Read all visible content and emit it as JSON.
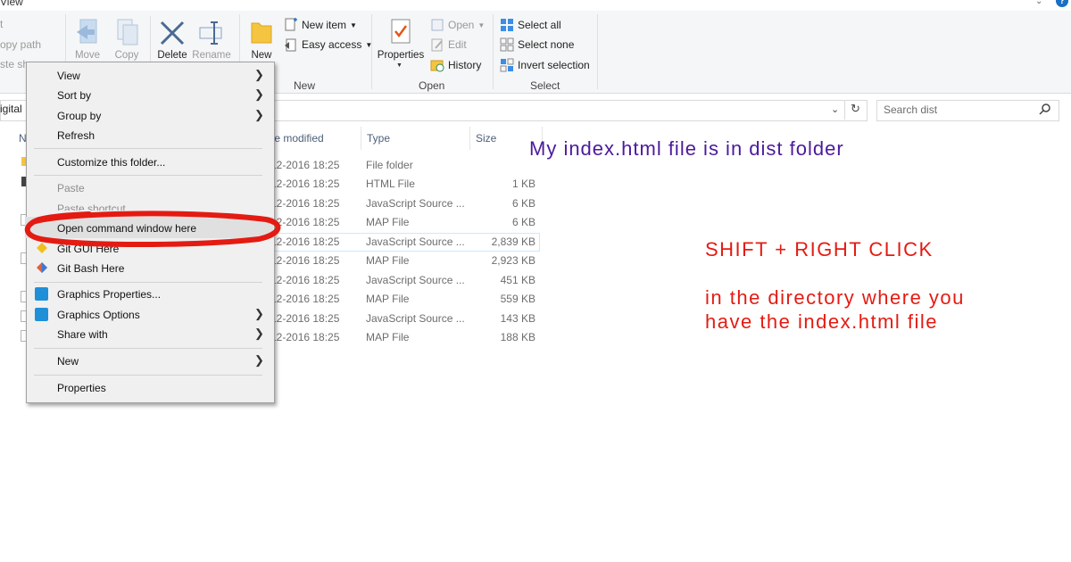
{
  "window": {
    "title_fragment": "View"
  },
  "ribbon": {
    "clipboard": {
      "copy_path": "opy path",
      "paste_shortcut": "ste sh",
      "top_fragment": "t"
    },
    "organize": {
      "move": "Move",
      "copy": "Copy",
      "delete": "Delete",
      "rename": "Rename"
    },
    "new": {
      "new_item": "New item",
      "easy_access": "Easy access",
      "new_folder": "New",
      "group": "New"
    },
    "open": {
      "properties": "Properties",
      "open": "Open",
      "edit": "Edit",
      "history": "History",
      "group": "Open"
    },
    "select": {
      "select_all": "Select all",
      "select_none": "Select none",
      "invert": "Invert selection",
      "group": "Select"
    }
  },
  "address": {
    "path_fragment": "igital",
    "search_placeholder": "Search dist"
  },
  "columns": {
    "name_fragment": "N",
    "date": "te modified",
    "type": "Type",
    "size": "Size"
  },
  "files": [
    {
      "date": "12-2016 18:25",
      "type": "File folder",
      "size": ""
    },
    {
      "date": "12-2016 18:25",
      "type": "HTML File",
      "size": "1 KB"
    },
    {
      "date": "12-2016 18:25",
      "type": "JavaScript Source ...",
      "size": "6 KB"
    },
    {
      "date": "12-2016 18:25",
      "type": "MAP File",
      "size": "6 KB"
    },
    {
      "date": "12-2016 18:25",
      "type": "JavaScript Source ...",
      "size": "2,839 KB"
    },
    {
      "date": "12-2016 18:25",
      "type": "MAP File",
      "size": "2,923 KB"
    },
    {
      "date": "12-2016 18:25",
      "type": "JavaScript Source ...",
      "size": "451 KB"
    },
    {
      "date": "12-2016 18:25",
      "type": "MAP File",
      "size": "559 KB"
    },
    {
      "date": "12-2016 18:25",
      "type": "JavaScript Source ...",
      "size": "143 KB"
    },
    {
      "date": "12-2016 18:25",
      "type": "MAP File",
      "size": "188 KB"
    }
  ],
  "menu": {
    "view": "View",
    "sort_by": "Sort by",
    "group_by": "Group by",
    "refresh": "Refresh",
    "customize": "Customize this folder...",
    "paste": "Paste",
    "paste_shortcut": "Paste shortcut",
    "open_cmd": "Open command window here",
    "git_gui": "Git GUI Here",
    "git_bash": "Git Bash Here",
    "graphics_properties": "Graphics Properties...",
    "graphics_options": "Graphics Options",
    "share_with": "Share with",
    "new": "New",
    "properties": "Properties"
  },
  "annotations": {
    "note1": "My index.html file is in dist folder",
    "note2": "SHIFT + RIGHT CLICK",
    "note3_line1": "in the directory where you",
    "note3_line2": "have the index.html file"
  },
  "colors": {
    "highlight_circle": "#e41b12",
    "note_purple": "#4b1a9c",
    "note_red": "#e41b12"
  }
}
